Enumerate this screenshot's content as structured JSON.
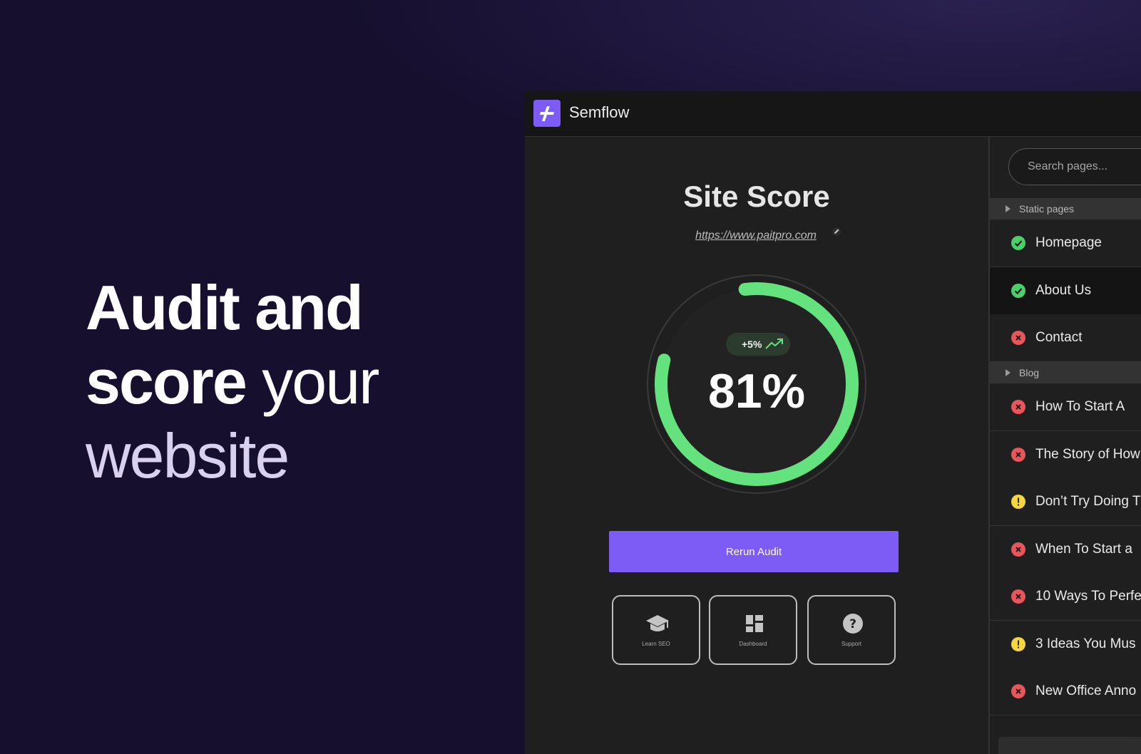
{
  "hero": {
    "line1_bold": "Audit and",
    "line2_bold": "score",
    "line2_light": " your",
    "line3": "website"
  },
  "app": {
    "name": "Semflow",
    "brand_color": "#7c5cf5"
  },
  "score_panel": {
    "title": "Site Score",
    "url": "https://www.paitpro.com",
    "score_value": 81,
    "score_label": "81%",
    "delta": "+5%",
    "gauge_color": "#63e27e",
    "rerun_label": "Rerun Audit"
  },
  "tiles": [
    {
      "label": "Learn SEO",
      "icon": "graduation-cap-icon"
    },
    {
      "label": "Dashboard",
      "icon": "dashboard-icon"
    },
    {
      "label": "Support",
      "icon": "help-icon"
    }
  ],
  "sidebar": {
    "search_placeholder": "Search pages...",
    "sections": [
      {
        "label": "Static pages",
        "pages": [
          {
            "label": "Homepage",
            "status": "pass"
          },
          {
            "label": "About Us",
            "status": "pass",
            "selected": true
          },
          {
            "label": "Contact",
            "status": "fail"
          }
        ]
      },
      {
        "label": "Blog",
        "pages": [
          {
            "label": "How To Start A",
            "status": "fail"
          },
          {
            "label": "The Story of How",
            "status": "fail"
          },
          {
            "label": "Don’t Try Doing T",
            "status": "warning"
          },
          {
            "label": "When To Start a",
            "status": "fail"
          },
          {
            "label": "10 Ways To Perfe",
            "status": "fail"
          },
          {
            "label": "3 Ideas You Mus",
            "status": "warning"
          },
          {
            "label": "New Office Anno",
            "status": "fail"
          }
        ]
      }
    ]
  },
  "status_colors": {
    "pass": "#4ccf6b",
    "fail": "#e8555a",
    "warning": "#f5d63d"
  }
}
